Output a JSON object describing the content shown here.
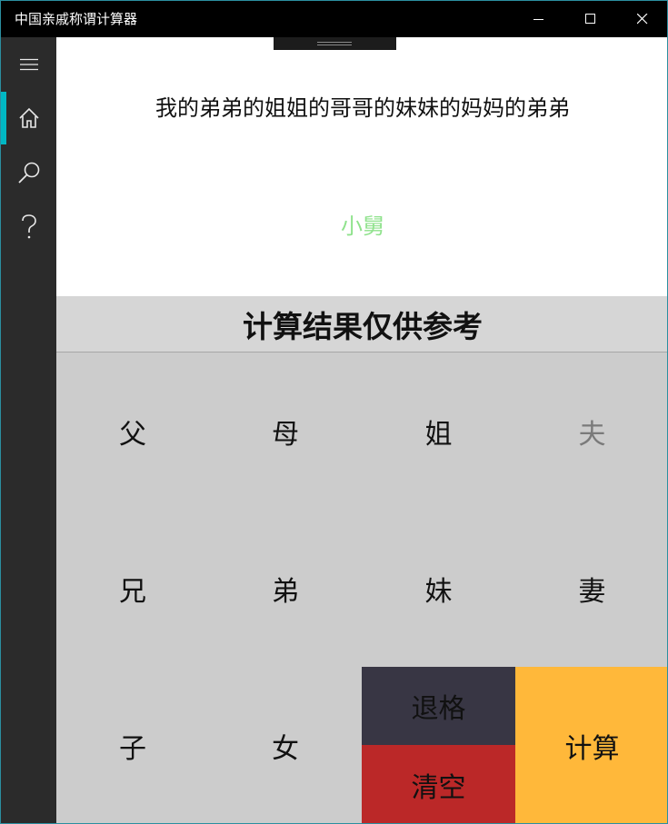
{
  "window": {
    "title": "中国亲戚称谓计算器"
  },
  "sidebar": {
    "items": [
      {
        "name": "menu",
        "icon": "hamburger-menu-icon"
      },
      {
        "name": "home",
        "icon": "home-icon",
        "active": true
      },
      {
        "name": "search",
        "icon": "search-icon"
      },
      {
        "name": "help",
        "icon": "question-mark-icon"
      }
    ],
    "accent_color": "#00b7c3"
  },
  "display": {
    "expression": "我的弟弟的姐姐的哥哥的妹妹的妈妈的弟弟",
    "result": "小舅",
    "result_color": "#8fe28c"
  },
  "notice": "计算结果仅供参考",
  "keypad": {
    "father": "父",
    "mother": "母",
    "older_sister": "姐",
    "husband": "夫",
    "older_brother": "兄",
    "younger_brother": "弟",
    "younger_sister": "妹",
    "wife": "妻",
    "son": "子",
    "daughter": "女",
    "backspace": "退格",
    "clear": "清空",
    "calculate": "计算"
  },
  "colors": {
    "backspace_bg": "#383644",
    "clear_bg": "#bb2828",
    "calculate_bg": "#ffb83a",
    "keypad_bg": "#cccccc"
  }
}
